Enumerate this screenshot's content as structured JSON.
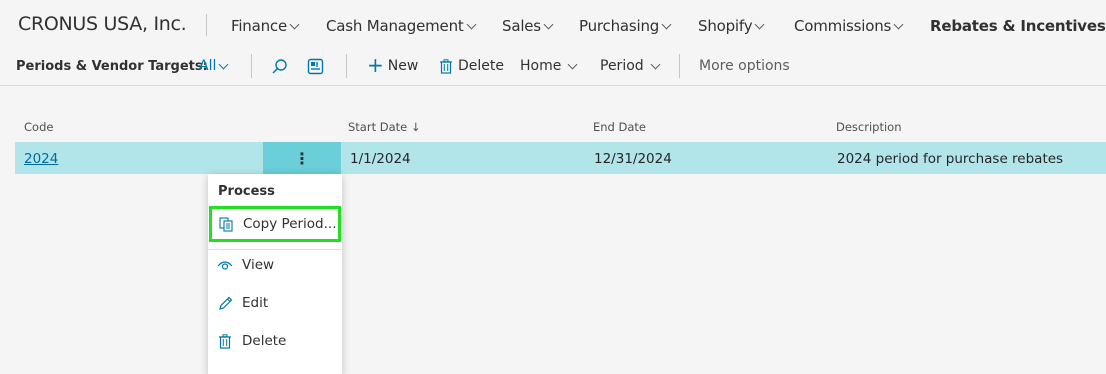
{
  "company": "CRONUS USA, Inc.",
  "nav": {
    "finance": "Finance",
    "cash_management": "Cash Management",
    "sales": "Sales",
    "purchasing": "Purchasing",
    "shopify": "Shopify",
    "commissions": "Commissions",
    "rebates": "Rebates & Incentives"
  },
  "actionbar": {
    "title": "Periods & Vendor Targets:",
    "filter": "All",
    "new_label": "New",
    "delete_label": "Delete",
    "home_label": "Home",
    "period_label": "Period",
    "more_options": "More options"
  },
  "table": {
    "columns": {
      "code": "Code",
      "start_date": "Start Date ↓",
      "end_date": "End Date",
      "description": "Description"
    },
    "rows": [
      {
        "code": "2024",
        "start_date": "1/1/2024",
        "end_date": "12/31/2024",
        "description": "2024 period for purchase rebates"
      }
    ]
  },
  "context_menu": {
    "section": "Process",
    "copy_period": "Copy Period...",
    "view": "View",
    "edit": "Edit",
    "delete": "Delete"
  },
  "colors": {
    "selected_row": "#b2e5ea",
    "row_menu_button": "#6acfd9",
    "highlight_outline": "#20e020",
    "link": "#006c9e"
  }
}
